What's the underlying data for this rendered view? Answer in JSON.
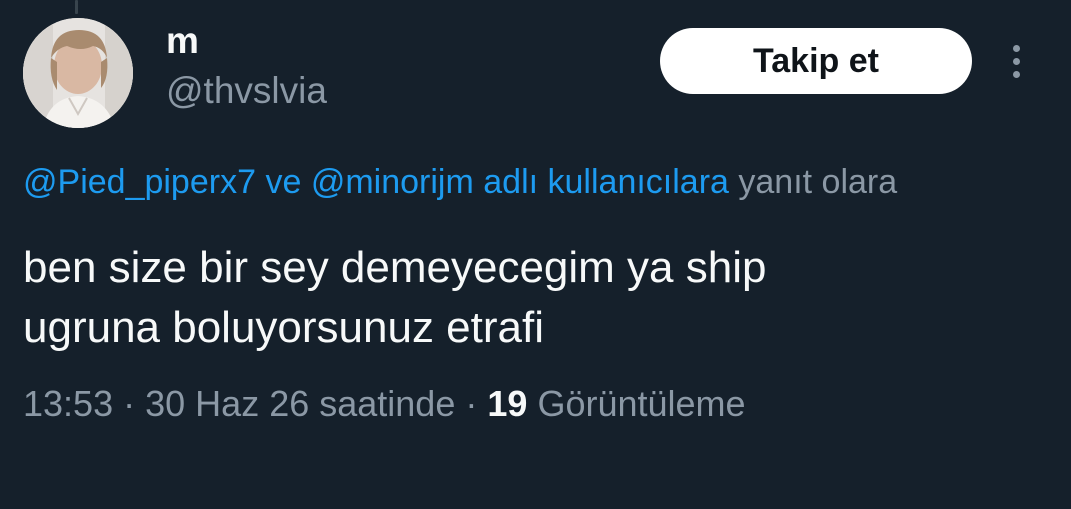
{
  "tweet": {
    "author": {
      "display_name": "m",
      "handle": "@thvslvia"
    },
    "follow_label": "Takip et",
    "more_icon": "more-vertical-icon",
    "reply_context": {
      "mention_1": "@Pied_piperx7",
      "connector": "ve",
      "mention_2": "@minorijm",
      "suffix_link": "adlı kullanıcılara",
      "suffix_text": "yanıt olara"
    },
    "text_lines": [
      "ben size bir sey demeyecegim ya ship",
      "ugruna boluyorsunuz etrafi"
    ],
    "time": "13:53",
    "separator": "·",
    "date": "30 Haz 26 saatinde",
    "views_count": "19",
    "views_label": "Görüntüleme"
  },
  "colors": {
    "background": "#15202b",
    "text_primary": "#f7f9f9",
    "text_secondary": "#8b98a5",
    "accent_link": "#1d9bf0",
    "follow_button_bg": "#ffffff",
    "follow_button_text": "#0f1419"
  }
}
